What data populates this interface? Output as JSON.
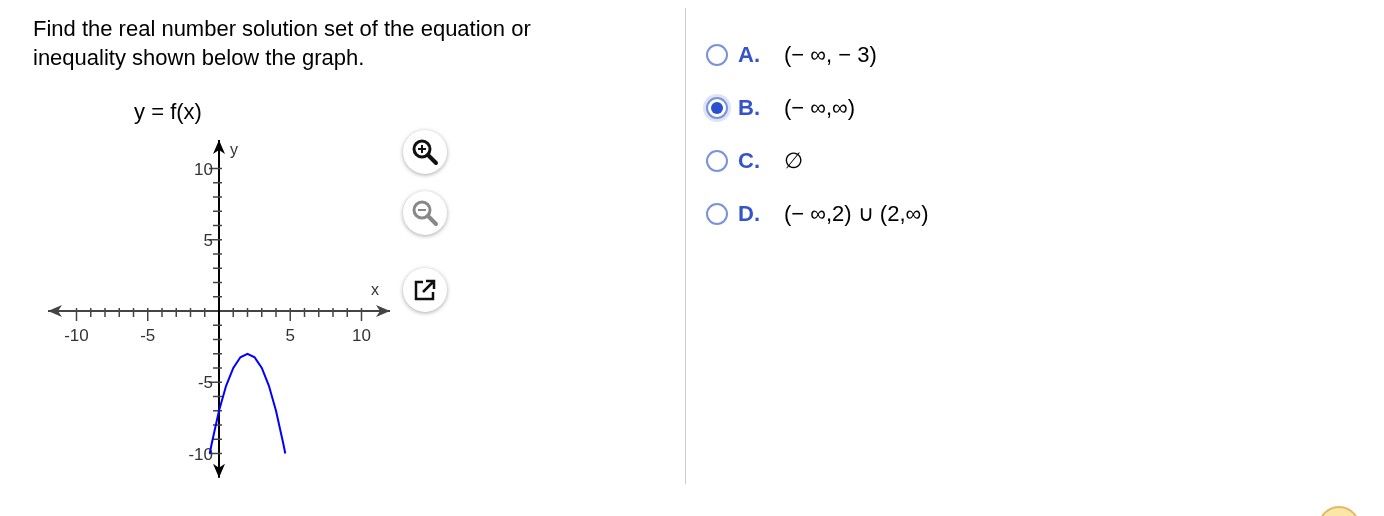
{
  "question": {
    "text": "Find the real number solution set of the equation or inequality shown below the graph."
  },
  "graph": {
    "chart_data": {
      "type": "line",
      "title": "y = f(x)",
      "xlabel": "x",
      "ylabel": "y",
      "xlim": [
        -12,
        12
      ],
      "ylim": [
        -11.7,
        12
      ],
      "xticks": [
        -10,
        -5,
        5,
        10
      ],
      "yticks": [
        -10,
        -5,
        5,
        10
      ],
      "x": [
        -0.65,
        -0.5,
        0,
        0.5,
        1,
        1.5,
        2,
        2.5,
        3,
        3.5,
        4,
        4.5,
        4.65
      ],
      "series": [
        {
          "color": "#0000ff",
          "values": [
            -10,
            -9.25,
            -7,
            -5.25,
            -4,
            -3.25,
            -3,
            -3.25,
            -4,
            -5.25,
            -7,
            -9.25,
            -10
          ]
        }
      ]
    }
  },
  "graph_tools": [
    {
      "kind": "zoom-in",
      "disabled": false
    },
    {
      "kind": "zoom-out",
      "disabled": true
    },
    {
      "kind": "popout",
      "disabled": false
    }
  ],
  "options": [
    {
      "letter": "A.",
      "text": "(− ∞, − 3)",
      "selected": false
    },
    {
      "letter": "B.",
      "text": "(− ∞,∞)",
      "selected": true
    },
    {
      "letter": "C.",
      "text": "∅",
      "selected": false
    },
    {
      "letter": "D.",
      "text": "(− ∞,2) ∪ (2,∞)",
      "selected": false
    }
  ]
}
